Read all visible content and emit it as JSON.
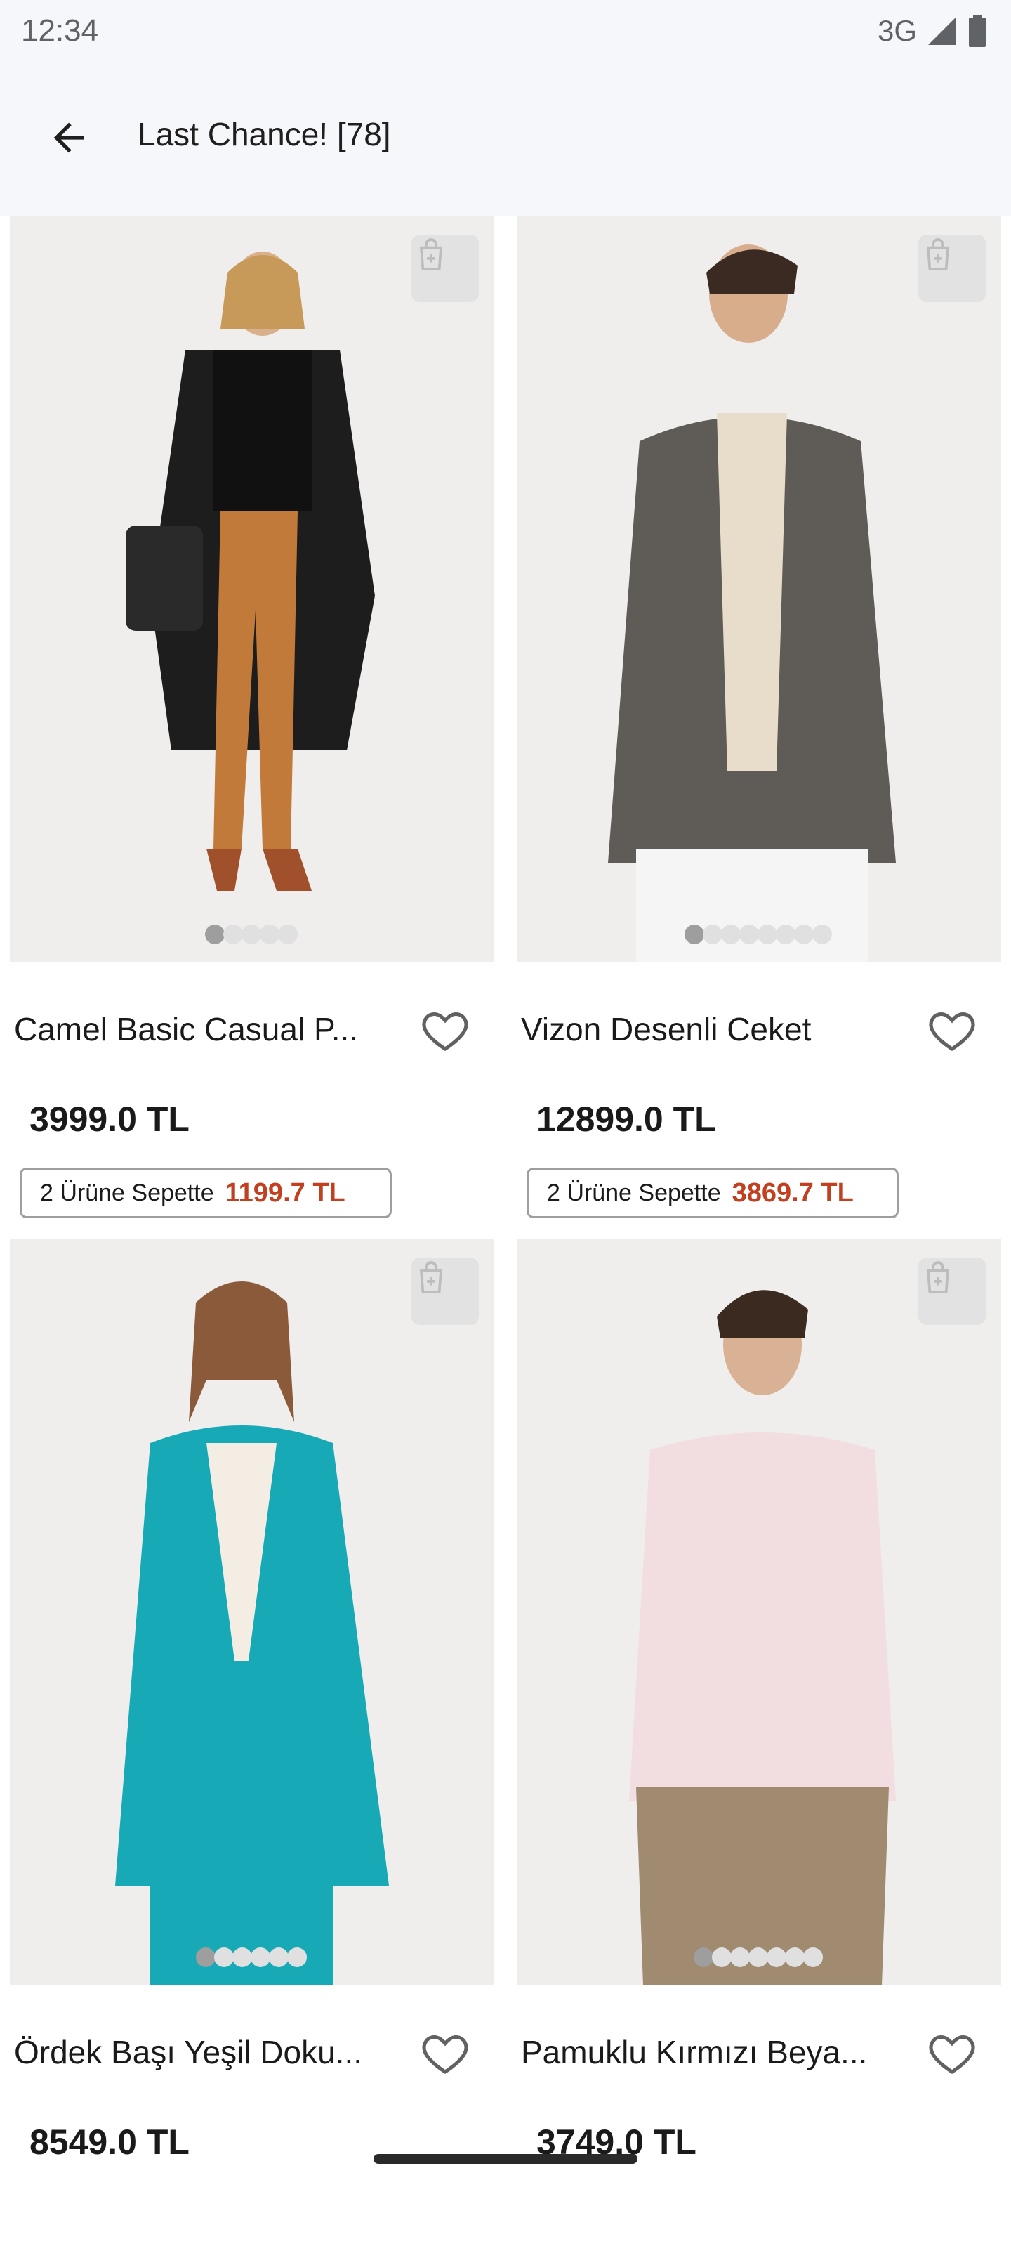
{
  "status_bar": {
    "time": "12:34",
    "network": "3G"
  },
  "header": {
    "back_icon": "arrow-left-icon",
    "title": "Last Chance! [78]"
  },
  "products": [
    {
      "name": "Camel Basic Casual P...",
      "price": "3999.0 TL",
      "promo_label": "2 Ürüne Sepette",
      "promo_price": "1199.7 TL",
      "dots": 5,
      "active_dot": 0
    },
    {
      "name": "Vizon Desenli Ceket",
      "price": "12899.0 TL",
      "promo_label": "2 Ürüne Sepette",
      "promo_price": "3869.7 TL",
      "dots": 8,
      "active_dot": 0
    },
    {
      "name": "Ördek Başı Yeşil Doku...",
      "price": "8549.0 TL",
      "dots": 6,
      "active_dot": 0
    },
    {
      "name": "Pamuklu Kırmızı Beya...",
      "price": "3749.0 TL",
      "dots": 7,
      "active_dot": 0
    }
  ],
  "colors": {
    "promo_price": "#c0401f",
    "bar_background": "#f6f7fb"
  }
}
